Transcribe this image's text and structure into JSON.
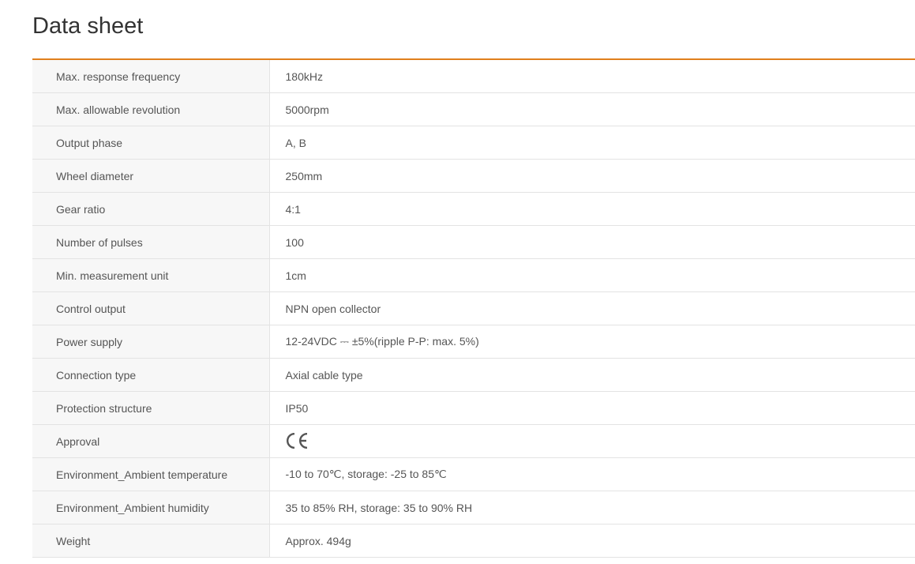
{
  "page": {
    "title": "Data sheet"
  },
  "colors": {
    "accent": "#e07f1c",
    "label_bg": "#f7f7f7",
    "border": "#e3e3e3",
    "text": "#555555"
  },
  "rows": [
    {
      "label": "Max. response frequency",
      "value": "180kHz"
    },
    {
      "label": "Max. allowable revolution",
      "value": "5000rpm"
    },
    {
      "label": "Output phase",
      "value": "A, B"
    },
    {
      "label": "Wheel diameter",
      "value": "250mm"
    },
    {
      "label": "Gear ratio",
      "value": "4:1"
    },
    {
      "label": "Number of pulses",
      "value": "100"
    },
    {
      "label": "Min. measurement unit",
      "value": "1cm"
    },
    {
      "label": "Control output",
      "value": "NPN open collector"
    },
    {
      "label": "Power supply",
      "value": "12-24VDC ⎓ ±5%(ripple P-P: max. 5%)"
    },
    {
      "label": "Connection type",
      "value": "Axial cable type"
    },
    {
      "label": "Protection structure",
      "value": "IP50"
    },
    {
      "label": "Approval",
      "icon": "ce-mark-icon"
    },
    {
      "label": "Environment_Ambient temperature",
      "value": "-10 to 70℃, storage: -25 to 85℃"
    },
    {
      "label": "Environment_Ambient humidity",
      "value": "35 to 85% RH, storage: 35 to 90% RH"
    },
    {
      "label": "Weight",
      "value": "Approx. 494g"
    }
  ]
}
